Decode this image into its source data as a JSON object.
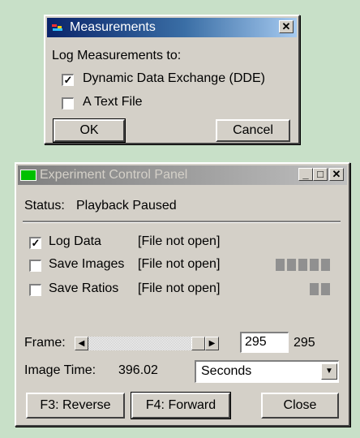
{
  "measurements": {
    "title": "Measurements",
    "close_glyph": "✕",
    "log_label": "Log Measurements to:",
    "options": [
      {
        "label": "Dynamic Data Exchange (DDE)",
        "checked": true
      },
      {
        "label": "A Text File",
        "checked": false
      }
    ],
    "ok_label": "OK",
    "cancel_label": "Cancel"
  },
  "control_panel": {
    "title": "Experiment Control Panel",
    "title_buttons": {
      "minimize": "_",
      "maximize": "□",
      "close": "✕"
    },
    "status_label": "Status:",
    "status_value": "Playback Paused",
    "rows": [
      {
        "label": "Log Data",
        "checked": true,
        "file_status": "[File not open]",
        "indicator_count": 0
      },
      {
        "label": "Save Images",
        "checked": false,
        "file_status": "[File not open]",
        "indicator_count": 5
      },
      {
        "label": "Save Ratios",
        "checked": false,
        "file_status": "[File not open]",
        "indicator_count": 2
      }
    ],
    "frame_label": "Frame:",
    "frame_value": "295",
    "frame_total": "295",
    "frame_slider_position": 1.0,
    "image_time_label": "Image Time:",
    "image_time_value": "396.02",
    "time_unit_selected": "Seconds",
    "reverse_label": "F3: Reverse",
    "forward_label": "F4: Forward",
    "close_label": "Close"
  }
}
